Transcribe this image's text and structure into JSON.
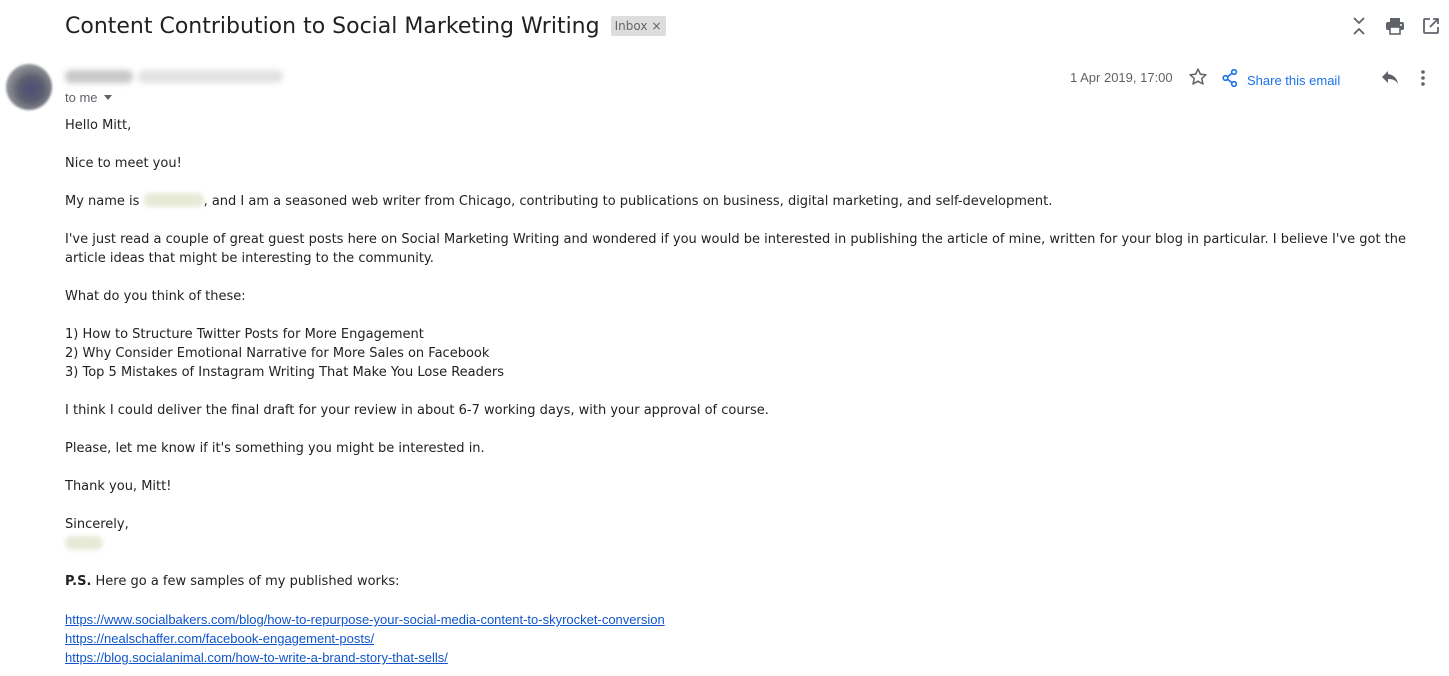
{
  "header": {
    "subject": "Content Contribution to Social Marketing Writing",
    "label": "Inbox",
    "label_remove": "×",
    "icons": [
      "expand-collapse-icon",
      "print-icon",
      "open-in-new-window-icon"
    ]
  },
  "message": {
    "to_line": "to me",
    "date": "1 Apr 2019, 17:00",
    "share_label": "Share this email",
    "icons": [
      "star-icon",
      "share-icon",
      "reply-icon",
      "more-vert-icon"
    ]
  },
  "body": {
    "greeting": "Hello Mitt,",
    "intro": "Nice to meet you!",
    "name_prefix": "My name is ",
    "name_suffix": ", and I am a seasoned web writer from Chicago, contributing to publications on business, digital marketing, and self-development.",
    "para1": "I've just read a couple of great guest posts here on Social Marketing Writing and wondered if you would be interested in publishing the article of mine, written for your blog in particular. I believe I've got the article ideas that might be interesting to the community.",
    "question": "What do you think of these:",
    "ideas": [
      "1) How to Structure Twitter Posts for More Engagement",
      "2) Why Consider Emotional Narrative for More Sales on Facebook",
      "3) Top 5 Mistakes of Instagram Writing That Make You Lose Readers"
    ],
    "delivery": "I think I could deliver the final draft for your review in about 6-7 working days, with your approval of course.",
    "ask": "Please, let me know if it's something you might be interested in.",
    "thanks": "Thank you, Mitt!",
    "signoff": "Sincerely,",
    "ps_label": "P.S.",
    "ps_text": " Here go a few samples of my published works:",
    "links": [
      "https://www.socialbakers.com/blog/how-to-repurpose-your-social-media-content-to-skyrocket-conversion",
      "https://nealschaffer.com/facebook-engagement-posts/",
      "https://blog.socialanimal.com/how-to-write-a-brand-story-that-sells/"
    ]
  },
  "colors": {
    "link": "#1155cc",
    "share_accent": "#1a73e8",
    "chip_bg": "#dddddd",
    "muted_text": "#5f6368"
  }
}
